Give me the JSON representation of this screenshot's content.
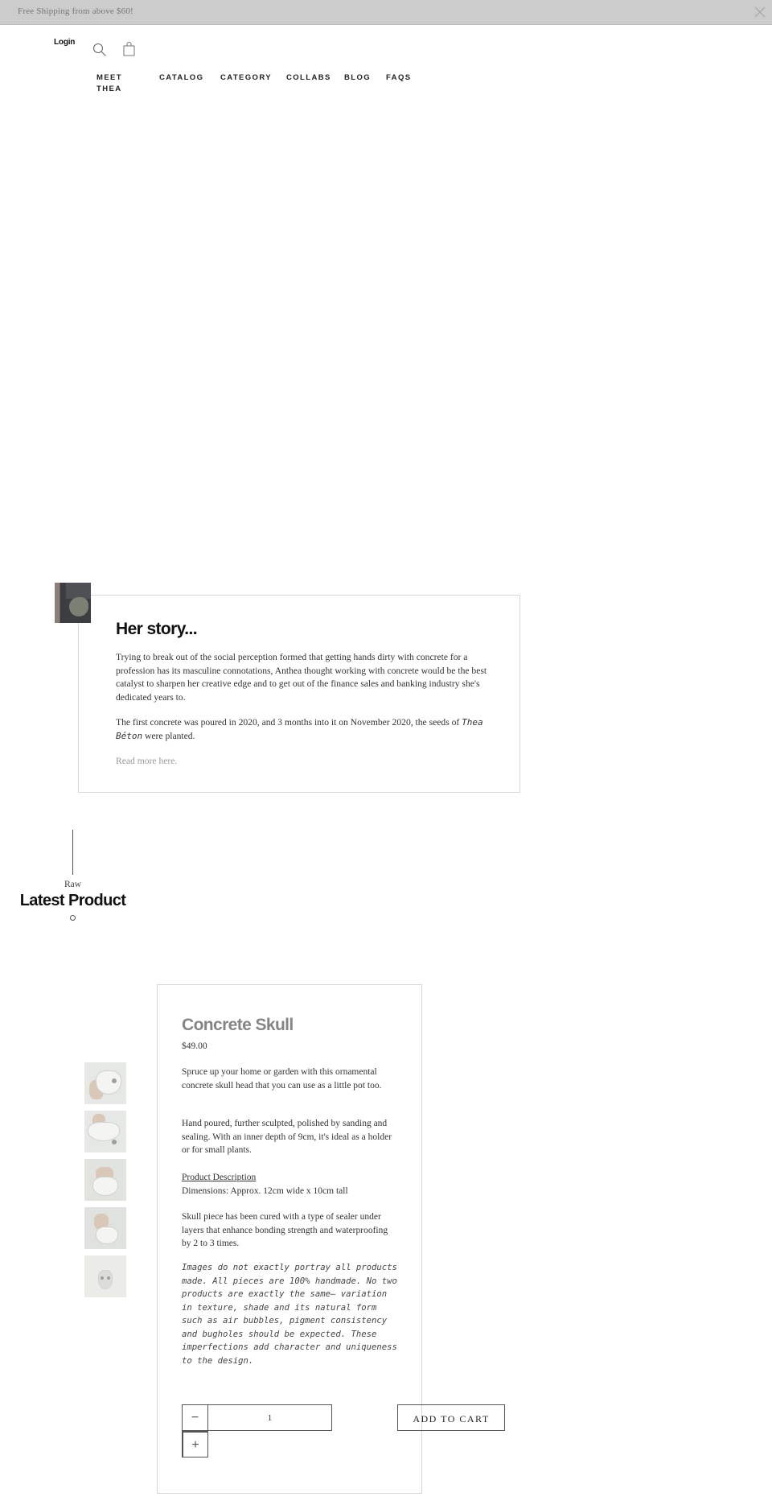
{
  "announcement": {
    "text": "Free Shipping from above $60!",
    "close_icon": "close-icon"
  },
  "header": {
    "login_label": "Login",
    "search_icon": "search-icon",
    "cart_icon": "shopping-bag-icon",
    "nav": [
      {
        "label": "MEET THEA"
      },
      {
        "label": "CATALOG"
      },
      {
        "label": "CATEGORY"
      },
      {
        "label": "COLLABS"
      },
      {
        "label": "BLOG"
      },
      {
        "label": "FAQS"
      }
    ]
  },
  "story": {
    "title": "Her story...",
    "paragraph1": "Trying to break out of the social perception formed that getting hands dirty with concrete for a profession has its masculine connotations, Anthea thought working with concrete would be the best catalyst to sharpen her creative edge and to get out of the finance sales and banking industry she's dedicated years to.",
    "paragraph2_before": "The first concrete was poured in 2020, and 3 months into it on November 2020, the seeds of ",
    "paragraph2_brand": "Thea Béton",
    "paragraph2_after": " were planted.",
    "read_more": "Read more here."
  },
  "latest": {
    "eyebrow": "Raw",
    "title": "Latest Product"
  },
  "product": {
    "title": "Concrete Skull",
    "price": "$49.00",
    "desc1": "Spruce up your home or garden with this ornamental concrete skull head that you can use as a little pot too.",
    "desc2": "Hand poured, further sculpted, polished by sanding and sealing. With an inner depth of 9cm, it's ideal as a holder or for small plants.",
    "desc_heading": "Product Description",
    "dimensions": "Dimensions: Approx. 12cm wide x 10cm tall",
    "desc3": "Skull piece has been cured with a type of sealer under layers that enhance bonding strength and waterproofing by 2 to 3 times.",
    "disclaimer": "Images do not exactly portray all products made. All pieces are 100% handmade. No two products are exactly the same— variation in texture, shade and its natural form such as air bubbles, pigment consistency and bugholes should be expected. These imperfections add character and uniqueness to the design.",
    "thumbnails": 5,
    "quantity": "1",
    "minus_label": "−",
    "plus_label": "+",
    "add_to_cart": "ADD TO CART"
  }
}
